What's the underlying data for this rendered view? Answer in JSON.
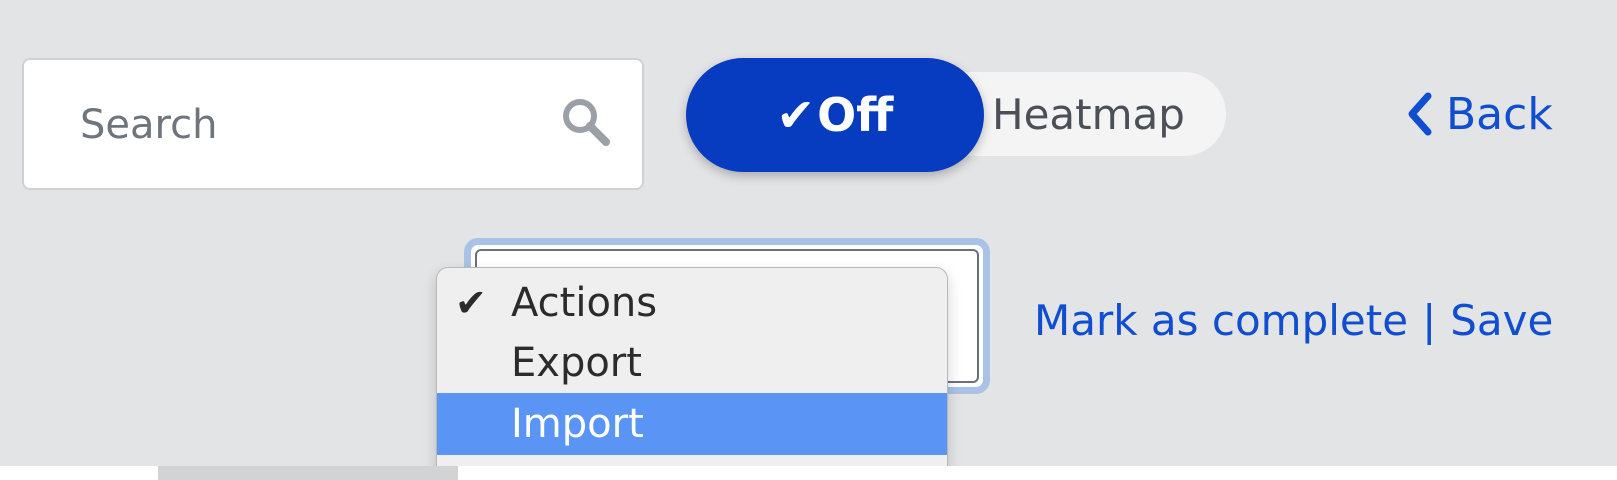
{
  "search": {
    "placeholder": "Search",
    "icon": "search-icon"
  },
  "toggle": {
    "active_label": "Off",
    "active_icon": "check-icon",
    "inactive_label": "Heatmap",
    "active_color": "#073cc0"
  },
  "navigation": {
    "back_label": "Back",
    "back_icon": "chevron-left-icon",
    "link_color": "#0f4ed1"
  },
  "actions_dropdown": {
    "selected": "Actions",
    "options": [
      {
        "label": "Actions",
        "checked": true,
        "highlighted": false
      },
      {
        "label": "Export",
        "checked": false,
        "highlighted": false
      },
      {
        "label": "Import",
        "checked": false,
        "highlighted": true
      }
    ],
    "highlight_color": "#5a95f5"
  },
  "status_actions": {
    "mark_complete_label": "Mark as complete",
    "separator": "|",
    "save_label": "Save"
  }
}
